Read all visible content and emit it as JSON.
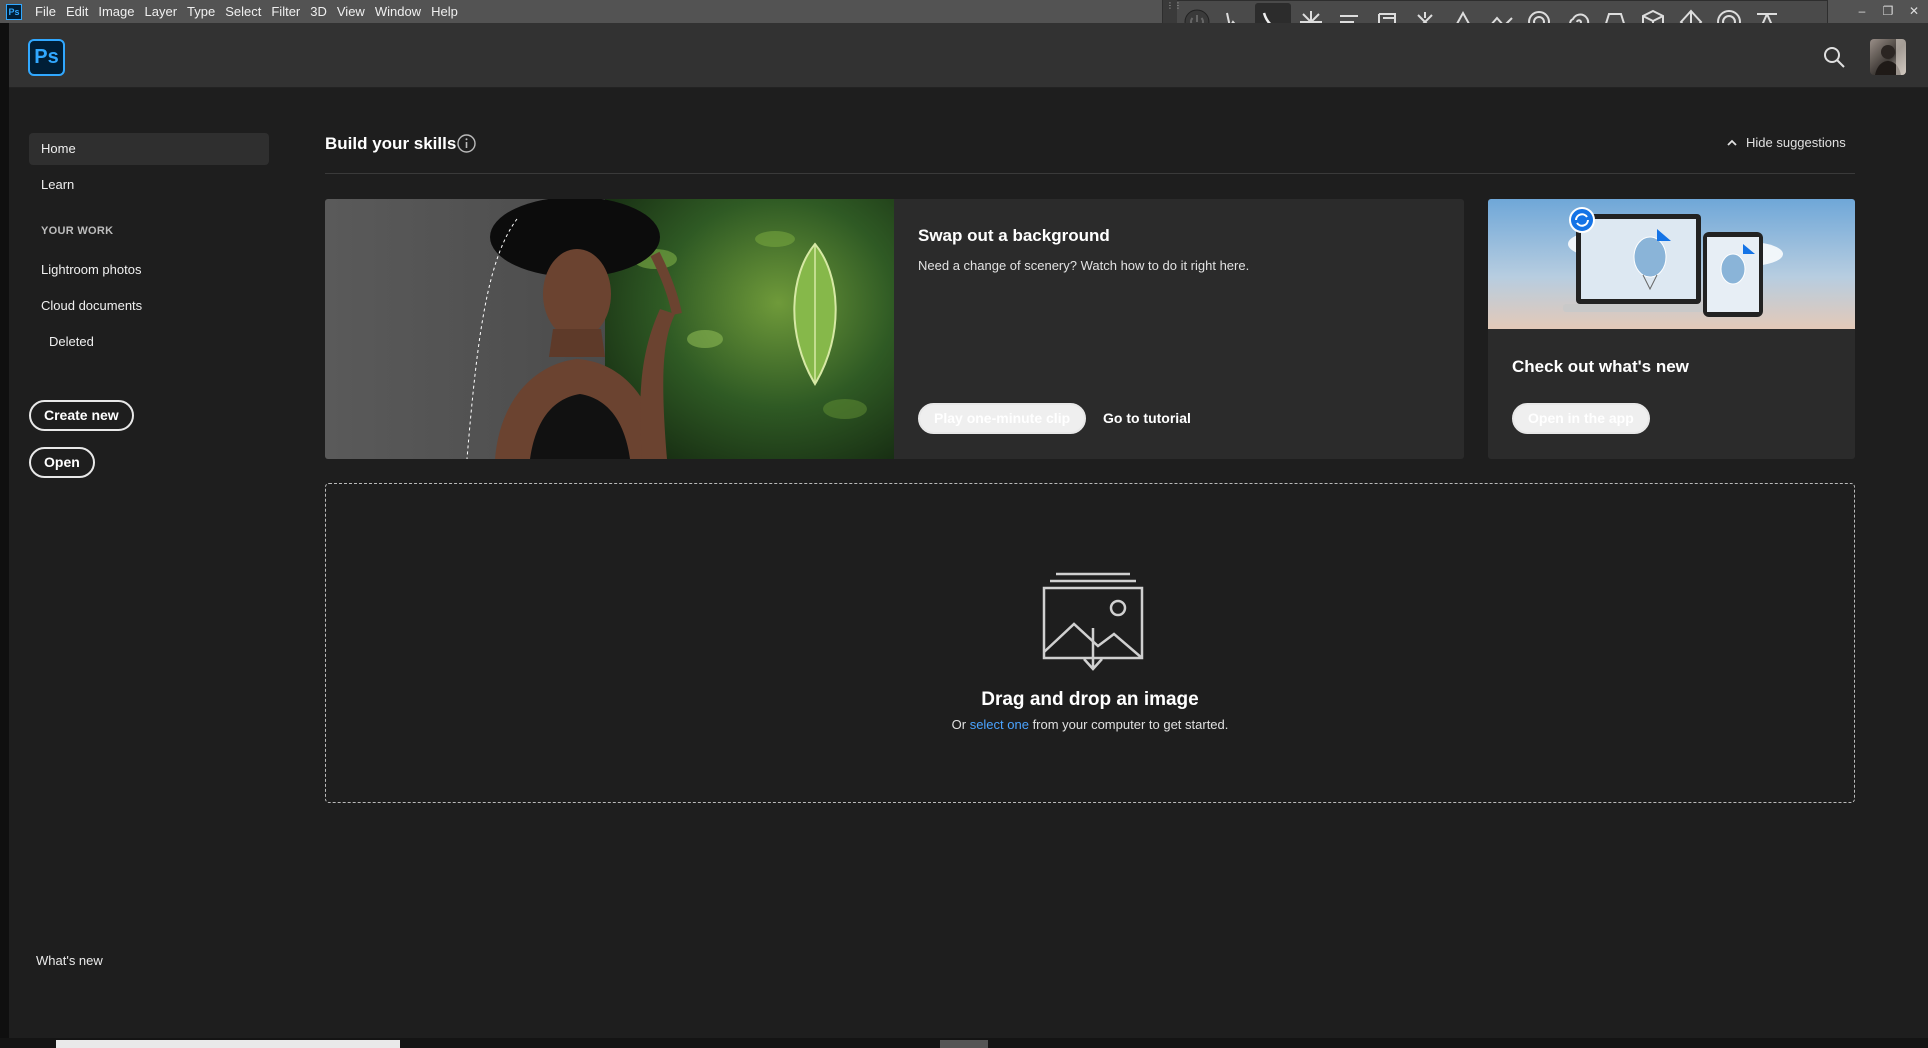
{
  "menubar": {
    "app_badge": "Ps",
    "items": [
      "File",
      "Edit",
      "Image",
      "Layer",
      "Type",
      "Select",
      "Filter",
      "3D",
      "View",
      "Window",
      "Help"
    ]
  },
  "toolpanel": {
    "tools": [
      "power-icon",
      "path-select-icon",
      "curve-icon",
      "starburst-icon",
      "align-lines-icon",
      "frame-icon",
      "snowflake-icon",
      "peak-icon",
      "zigzag-icon",
      "circle-spiral-icon",
      "spiral-icon",
      "perspective-box-icon",
      "cube-icon",
      "diamond-icon",
      "ring-icon",
      "tripod-icon"
    ]
  },
  "header": {
    "logo": "Ps"
  },
  "sidebar": {
    "home": "Home",
    "learn": "Learn",
    "your_work_heading": "YOUR WORK",
    "lightroom": "Lightroom photos",
    "cloud_documents": "Cloud documents",
    "deleted": "Deleted",
    "create_new": "Create new",
    "open": "Open",
    "whats_new": "What's new"
  },
  "main": {
    "title": "Build your skills",
    "hide_suggestions": "Hide suggestions",
    "card": {
      "title": "Swap out a background",
      "description": "Need a change of scenery? Watch how to do it right here.",
      "play_button": "Play one-minute clip",
      "tutorial_link": "Go to tutorial"
    },
    "side_card": {
      "title": "Check out what's new",
      "button": "Open in the app"
    },
    "dropzone": {
      "title": "Drag and drop an image",
      "sub_prefix": "Or ",
      "sub_link": "select one",
      "sub_suffix": " from your computer to get started."
    }
  },
  "colors": {
    "accent": "#31a8ff",
    "link": "#4aa3ff",
    "background": "#1e1e1e",
    "card": "#2b2b2b"
  }
}
